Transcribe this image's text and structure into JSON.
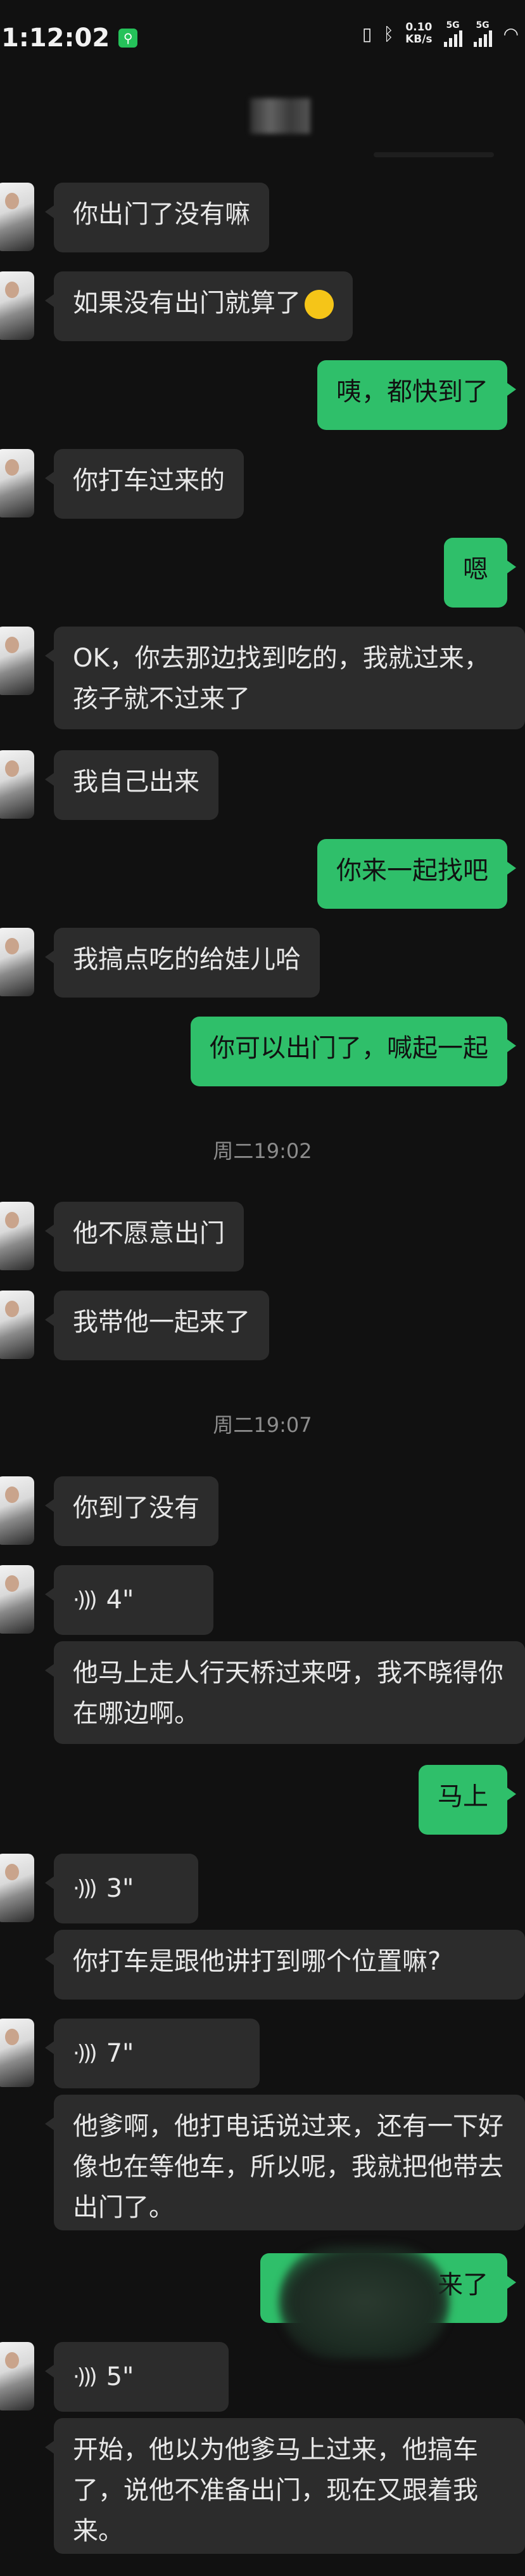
{
  "status_bar": {
    "time": "1:12:02",
    "speed_value": "0.10",
    "speed_unit": "KB/s",
    "sig1": "5G",
    "sig2": "5G"
  },
  "messages": [
    {
      "side": "left",
      "text": "你出门了没有嘛"
    },
    {
      "side": "left",
      "text": "如果没有出门就算了"
    },
    {
      "side": "right",
      "text": "咦，都快到了"
    },
    {
      "side": "left",
      "text": "你打车过来的"
    },
    {
      "side": "right",
      "text": "嗯"
    },
    {
      "side": "left",
      "text": "OK，你去那边找到吃的，我就过来，孩子就不过来了"
    },
    {
      "side": "left",
      "text": "我自己出来"
    },
    {
      "side": "right",
      "text": "你来一起找吧"
    },
    {
      "side": "left",
      "text": "我搞点吃的给娃儿哈"
    },
    {
      "side": "right",
      "text": "你可以出门了，喊起一起"
    },
    {
      "side": "time",
      "text": "周二19:02"
    },
    {
      "side": "left",
      "text": "他不愿意出门"
    },
    {
      "side": "left",
      "text": "我带他一起来了"
    },
    {
      "side": "time",
      "text": "周二19:07"
    },
    {
      "side": "left",
      "text": "你到了没有"
    },
    {
      "side": "left",
      "voice": "4\""
    },
    {
      "side": "left",
      "text": "他马上走人行天桥过来呀，我不晓得你在哪边啊。"
    },
    {
      "side": "right",
      "text": "马上"
    },
    {
      "side": "left",
      "voice": "3\""
    },
    {
      "side": "left",
      "text": "你打车是跟他讲打到哪个位置嘛?"
    },
    {
      "side": "left",
      "voice": "7\""
    },
    {
      "side": "left",
      "text": "他爹啊，他打电话说过来，还有一下好像也在等他车，所以呢，我就把他带去出门了。"
    },
    {
      "side": "right",
      "text": "来了"
    },
    {
      "side": "left",
      "voice": "5\""
    },
    {
      "side": "left",
      "text": "开始，他以为他爹马上过来，他搞车了，说他不准备出门，现在又跟着我来。"
    }
  ],
  "icons": {
    "voice": "sound-wave-icon",
    "emoji": "thinking-face-icon"
  },
  "colors": {
    "background": "#111111",
    "left_bubble": "#2c2c2c",
    "right_bubble": "#2fbf6a"
  }
}
